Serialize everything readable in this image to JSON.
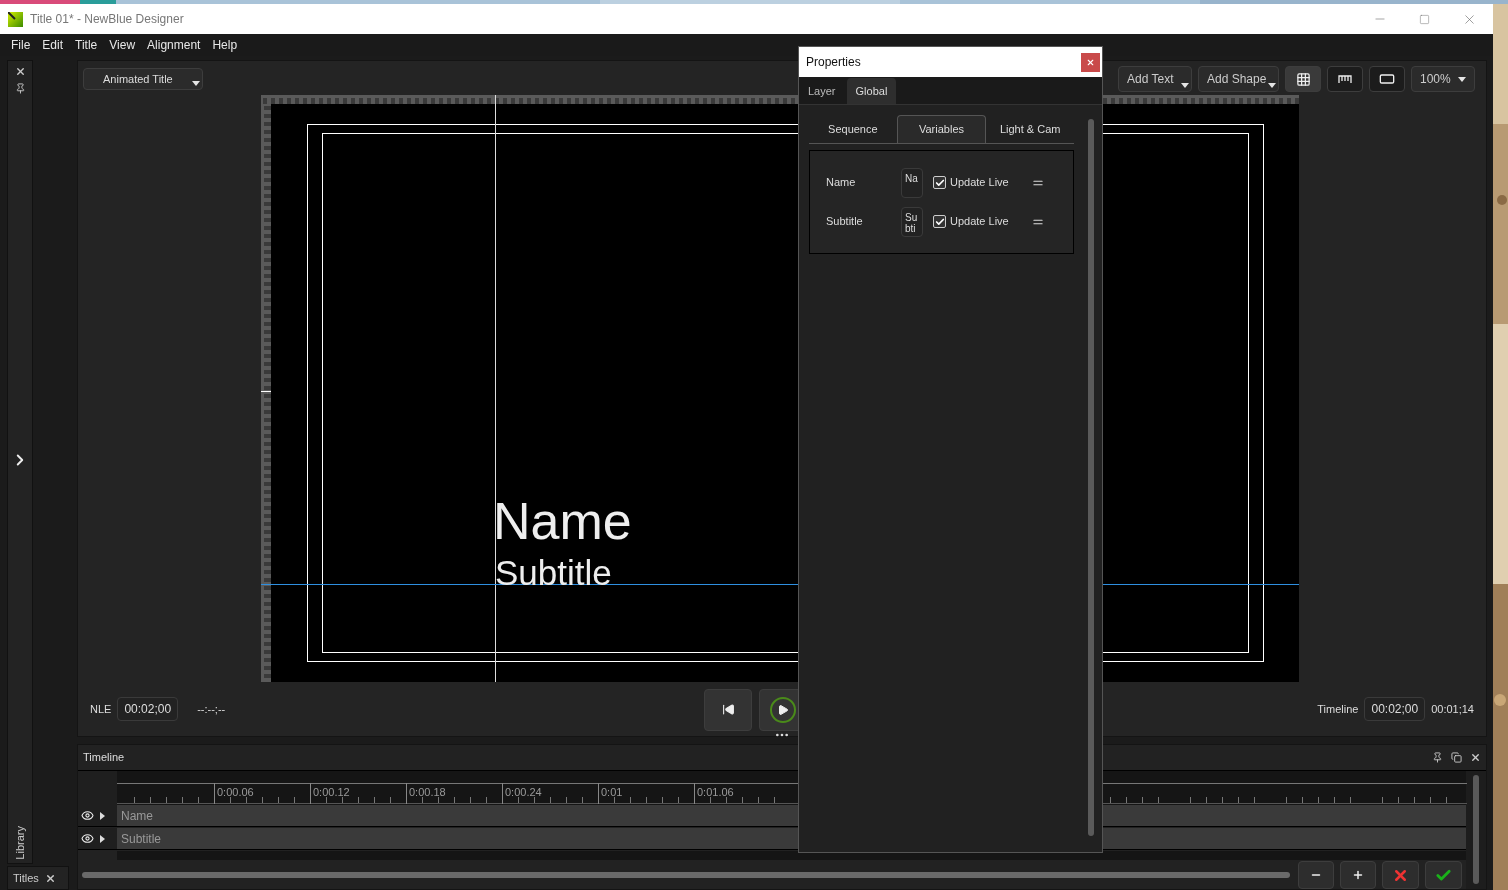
{
  "window": {
    "title": "Title 01* - NewBlue Designer"
  },
  "menu": [
    "File",
    "Edit",
    "Title",
    "View",
    "Alignment",
    "Help"
  ],
  "side_dock": {
    "tab": "Library"
  },
  "bottom_dock": {
    "tab": "Titles"
  },
  "editor": {
    "template": "Animated Title",
    "toolbar": {
      "add_text": "Add Text",
      "add_shape": "Add Shape",
      "toggles": [
        {
          "kind": "grid",
          "selected": true
        },
        {
          "kind": "ruler",
          "selected": false
        },
        {
          "kind": "safe-area",
          "selected": false
        }
      ],
      "zoom": "100%"
    },
    "canvas": {
      "name": "Name",
      "subtitle": "Subtitle"
    },
    "nle": {
      "label": "NLE",
      "duration": "00:02;00",
      "position": "--:--;--"
    },
    "timeline_time": {
      "label": "Timeline",
      "duration": "00:02;00",
      "position": "00:01;14"
    }
  },
  "timeline": {
    "title": "Timeline",
    "ticks": [
      "0:00.06",
      "0:00.12",
      "0:00.18",
      "0:00.24",
      "0:01",
      "0:01.06"
    ],
    "tracks": [
      {
        "name": "Name"
      },
      {
        "name": "Subtitle"
      }
    ]
  },
  "properties": {
    "title": "Properties",
    "tabs": [
      {
        "label": "Layer",
        "selected": false
      },
      {
        "label": "Global",
        "selected": true
      }
    ],
    "subtabs": [
      {
        "label": "Sequence",
        "selected": false
      },
      {
        "label": "Variables",
        "selected": true
      },
      {
        "label": "Light & Cam",
        "selected": false
      }
    ],
    "variables": [
      {
        "label": "Name",
        "value": "Na",
        "update_live": {
          "label": "Update Live",
          "checked": true
        }
      },
      {
        "label": "Subtitle",
        "value": "Subti",
        "update_live": {
          "label": "Update Live",
          "checked": true
        }
      }
    ]
  }
}
